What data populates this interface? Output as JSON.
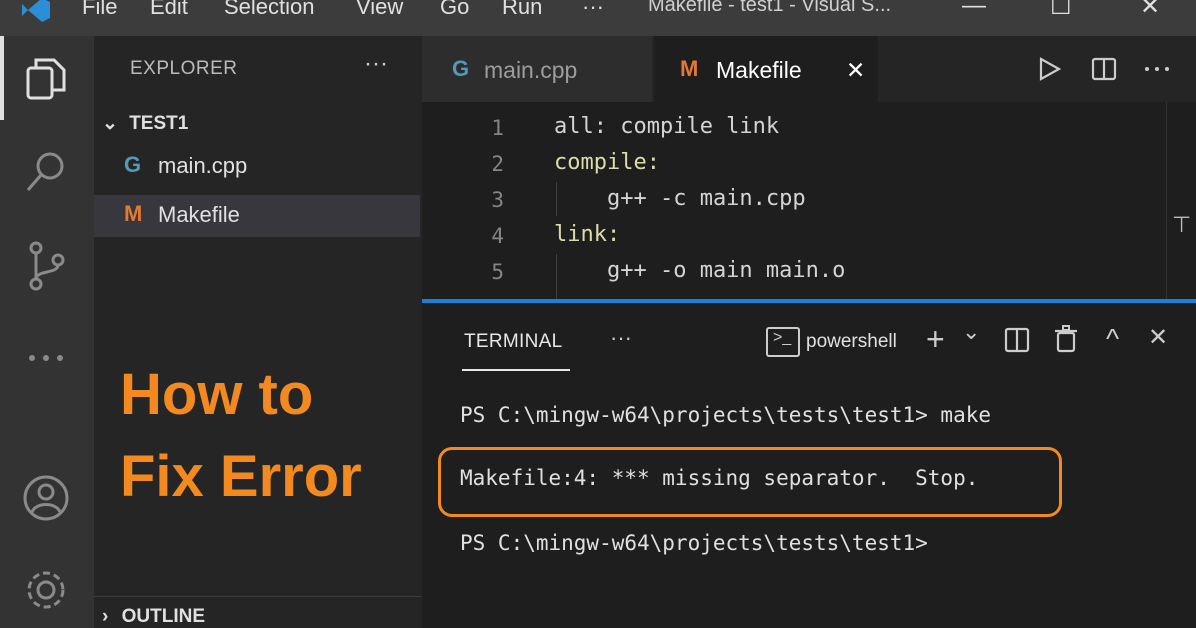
{
  "titlebar": {
    "menus": [
      "File",
      "Edit",
      "Selection",
      "View",
      "Go",
      "Run",
      "···"
    ],
    "title": "Makefile - test1 - Visual S...",
    "minimize": "—",
    "maximize": "☐",
    "close": "✕"
  },
  "sidebar": {
    "title": "EXPLORER",
    "more": "···",
    "folder": "TEST1",
    "files": [
      {
        "icon": "G",
        "name": "main.cpp"
      },
      {
        "icon": "M",
        "name": "Makefile"
      }
    ],
    "promo_line1": "How to",
    "promo_line2": "Fix Error",
    "outline": "OUTLINE"
  },
  "tabs": [
    {
      "icon": "G",
      "label": "main.cpp"
    },
    {
      "icon": "M",
      "label": "Makefile",
      "close": "✕"
    }
  ],
  "editor": {
    "lines": [
      {
        "n": "1",
        "text": "all: compile link"
      },
      {
        "n": "2",
        "text": "compile:"
      },
      {
        "n": "3",
        "text": "    g++ -c main.cpp"
      },
      {
        "n": "4",
        "text": "link:"
      },
      {
        "n": "5",
        "text": "    g++ -o main main.o"
      }
    ]
  },
  "panel": {
    "tab": "TERMINAL",
    "more": "···",
    "shell": "powershell",
    "add": "+",
    "dropdown": "⌄",
    "up": "^",
    "close": "✕",
    "terminal": [
      "PS C:\\mingw-w64\\projects\\tests\\test1> make",
      "Makefile:4: *** missing separator.  Stop.",
      "PS C:\\mingw-w64\\projects\\tests\\test1>"
    ]
  },
  "colors": {
    "accent_orange": "#f28a1f",
    "panel_border": "#1f7fd8",
    "cpp_icon": "#519aba",
    "makefile_icon": "#e37933"
  }
}
